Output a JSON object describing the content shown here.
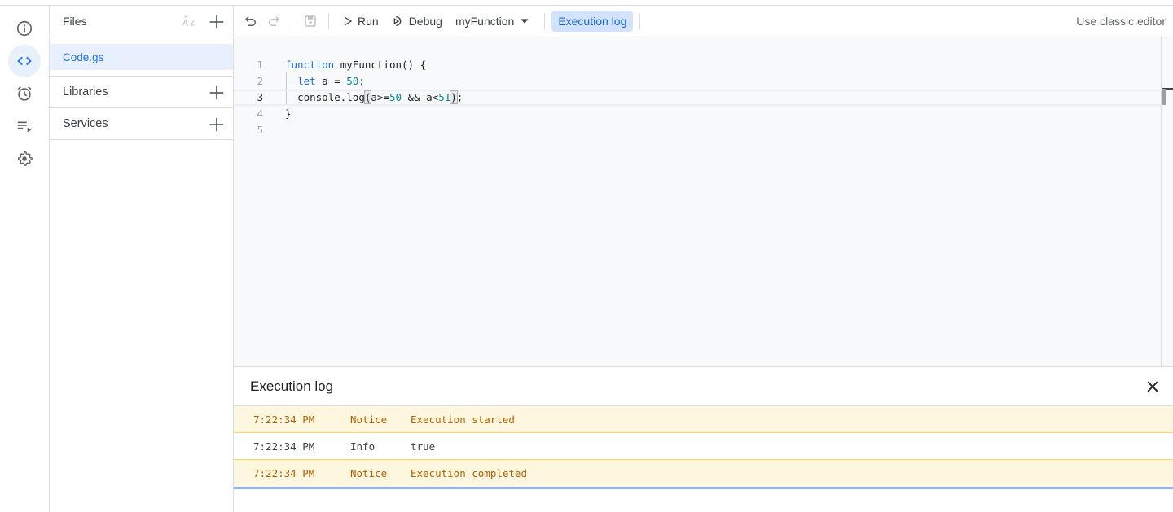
{
  "rail": {
    "items": [
      {
        "name": "overview",
        "icon": "info-icon",
        "active": false
      },
      {
        "name": "editor",
        "icon": "code-icon",
        "active": true
      },
      {
        "name": "triggers",
        "icon": "alarm-icon",
        "active": false
      },
      {
        "name": "executions",
        "icon": "executions-icon",
        "active": false
      },
      {
        "name": "settings",
        "icon": "gear-icon",
        "active": false
      }
    ]
  },
  "files": {
    "title": "Files",
    "items": [
      {
        "label": "Code.gs",
        "selected": true
      }
    ],
    "sections": [
      {
        "label": "Libraries"
      },
      {
        "label": "Services"
      }
    ]
  },
  "toolbar": {
    "run_label": "Run",
    "debug_label": "Debug",
    "function_select": "myFunction",
    "execution_log_label": "Execution log",
    "classic_editor_label": "Use classic editor"
  },
  "editor": {
    "current_line": 3,
    "lines": [
      {
        "number": "1",
        "text": "function myFunction() {"
      },
      {
        "number": "2",
        "text": "  let a = 50;"
      },
      {
        "number": "3",
        "text": "  console.log(a>=50 && a<51);"
      },
      {
        "number": "4",
        "text": "}"
      },
      {
        "number": "5",
        "text": ""
      }
    ],
    "tokens": {
      "l1_kw": "function",
      "l1_rest": " myFunction() {",
      "l2_kw": "let",
      "l2_mid": " a = ",
      "l2_num": "50",
      "l2_end": ";",
      "l3_a": "console.log",
      "l3_open": "(",
      "l3_b": "a>=",
      "l3_n1": "50",
      "l3_c": " && a<",
      "l3_n2": "51",
      "l3_close": ")",
      "l3_end": ";",
      "l4": "}"
    }
  },
  "execution_log": {
    "title": "Execution log",
    "rows": [
      {
        "time": "7:22:34 PM",
        "level": "Notice",
        "message": "Execution started"
      },
      {
        "time": "7:22:34 PM",
        "level": "Info",
        "message": "true"
      },
      {
        "time": "7:22:34 PM",
        "level": "Notice",
        "message": "Execution completed"
      }
    ]
  },
  "colors": {
    "accent": "#1a73e8",
    "notice_bg": "#fef7e0",
    "notice_text": "#b06000"
  }
}
